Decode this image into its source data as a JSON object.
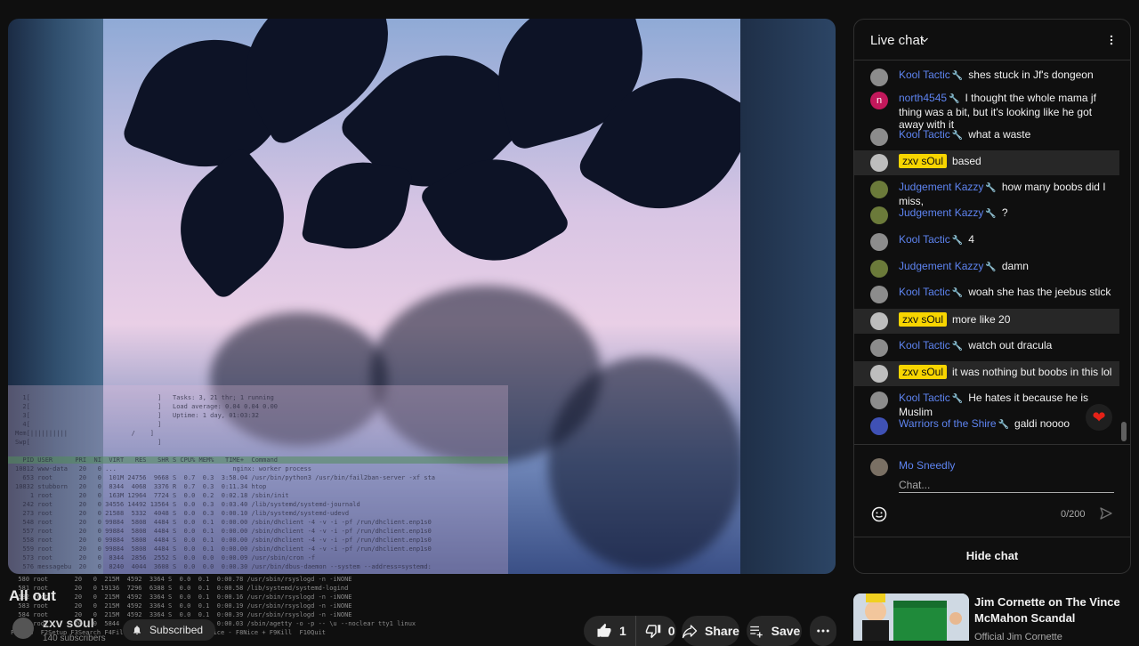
{
  "video": {
    "title": "All out",
    "channel": "zxv sOul",
    "subscribers": "140 subscribers",
    "subscribe_state": "Subscribed",
    "likes": "1",
    "dislikes": "0",
    "share_label": "Share",
    "save_label": "Save"
  },
  "terminal_overlay": {
    "lines": [
      "  1[                                  ]   Tasks: 3, 21 thr; 1 running",
      "  2[                                  ]   Load average: 0.04 0.04 0.00",
      "  3[                                  ]   Uptime: 1 day, 01:03:32",
      "  4[                                  ]",
      "Mem[||||||||||                 /    ]",
      "Swp[                                  ]",
      "",
      "  PID USER      PRI  NI  VIRT   RES   SHR S CPU% MEM%   TIME+  Command",
      "10812 www-data   20   0 ...                               nginx: worker process",
      "  653 root       20   0  101M 24756  9668 S  0.7  0.3  3:58.04 /usr/bin/python3 /usr/bin/fail2ban-server -xf sta",
      "10832 stubborn   20   0  8344  4068  3376 R  0.7  0.3  0:11.34 htop",
      "    1 root       20   0  163M 12964  7724 S  0.0  0.2  0:02.18 /sbin/init",
      "  242 root       20   0 34556 14492 13564 S  0.0  0.3  0:03.40 /lib/systemd/systemd-journald",
      "  273 root       20   0 21588  5332  4048 S  0.0  0.3  0:00.10 /lib/systemd/systemd-udevd",
      "  548 root       20   0 99884  5808  4484 S  0.0  0.1  0:00.00 /sbin/dhclient -4 -v -i -pf /run/dhclient.enp1s0",
      "  557 root       20   0 99884  5808  4484 S  0.0  0.1  0:00.00 /sbin/dhclient -4 -v -i -pf /run/dhclient.enp1s0",
      "  558 root       20   0 99884  5808  4484 S  0.0  0.1  0:00.00 /sbin/dhclient -4 -v -i -pf /run/dhclient.enp1s0",
      "  559 root       20   0 99884  5808  4484 S  0.0  0.1  0:00.00 /sbin/dhclient -4 -v -i -pf /run/dhclient.enp1s0",
      "  573 root       20   0  8344  2856  2552 S  0.0  0.0  0:00.09 /usr/sbin/cron -f",
      "  576 messagebu  20   0  8240  4044  3608 S  0.0  0.0  0:00.30 /usr/bin/dbus-daemon --system --address=systemd:"
    ]
  },
  "bottom_terminal": {
    "lines": [
      "  580 root       20   0  215M  4592  3364 S  0.0  0.1  0:00.78 /usr/sbin/rsyslogd -n -iNONE",
      "  581 root       20   0 19136  7296  6388 S  0.0  0.1  0:00.58 /lib/systemd/systemd-logind",
      "  582 root       20   0  215M  4592  3364 S  0.0  0.1  0:00.16 /usr/sbin/rsyslogd -n -iNONE",
      "  583 root       20   0  215M  4592  3364 S  0.0  0.1  0:00.19 /usr/sbin/rsyslogd -n -iNONE",
      "  584 root       20   0  215M  4592  3364 S  0.0  0.1  0:00.39 /usr/sbin/rsyslogd -n -iNONE",
      "  585 root       20   0  5844  1560  1448 S  0.0  0.0  0:00.03 /sbin/agetty -o -p -- \\u --noclear tty1 linux",
      "F1Help  F2Setup F3Search F4Filter F5Tree  F6SortBy F7Nice - F8Nice + F9Kill  F10Quit"
    ]
  },
  "chat": {
    "title": "Live chat",
    "input_placeholder": "Chat...",
    "user_name": "Mo Sneedly",
    "char_count": "0/200",
    "hide_label": "Hide chat",
    "messages": [
      {
        "author": "Kool Tactic",
        "text": "shes stuck in Jf's dongeon",
        "badge": false,
        "moderator": true
      },
      {
        "author": "north4545",
        "text": "I thought the whole mama jf thing was a bit, but it's looking like he got away with it",
        "badge": false,
        "moderator": true
      },
      {
        "author": "Kool Tactic",
        "text": "what a waste",
        "badge": false,
        "moderator": true
      },
      {
        "author": "zxv sOul",
        "text": "based",
        "badge": true,
        "moderator": false
      },
      {
        "author": "Judgement Kazzy",
        "text": "how many boobs did I miss,",
        "badge": false,
        "moderator": true
      },
      {
        "author": "Judgement Kazzy",
        "text": "?",
        "badge": false,
        "moderator": true
      },
      {
        "author": "Kool Tactic",
        "text": "4",
        "badge": false,
        "moderator": true
      },
      {
        "author": "Judgement Kazzy",
        "text": "damn",
        "badge": false,
        "moderator": true
      },
      {
        "author": "Kool Tactic",
        "text": "woah she has the jeebus stick",
        "badge": false,
        "moderator": true
      },
      {
        "author": "zxv sOul",
        "text": "more like 20",
        "badge": true,
        "moderator": false
      },
      {
        "author": "Kool Tactic",
        "text": "watch out dracula",
        "badge": false,
        "moderator": true
      },
      {
        "author": "zxv sOul",
        "text": "it was nothing but boobs in this lol",
        "badge": true,
        "moderator": false
      },
      {
        "author": "Kool Tactic",
        "text": "He hates it because he is Muslim",
        "badge": false,
        "moderator": true
      },
      {
        "author": "Warriors of the Shire",
        "text": "galdi noooo",
        "badge": false,
        "moderator": true
      }
    ]
  },
  "recommended": {
    "title": "Jim Cornette on The Vince McMahon Scandal",
    "channel": "Official Jim Cornette"
  },
  "colors": {
    "author_blue": "#5e84f1",
    "owner_badge": "#f8d500",
    "background": "#0f0f0f"
  }
}
